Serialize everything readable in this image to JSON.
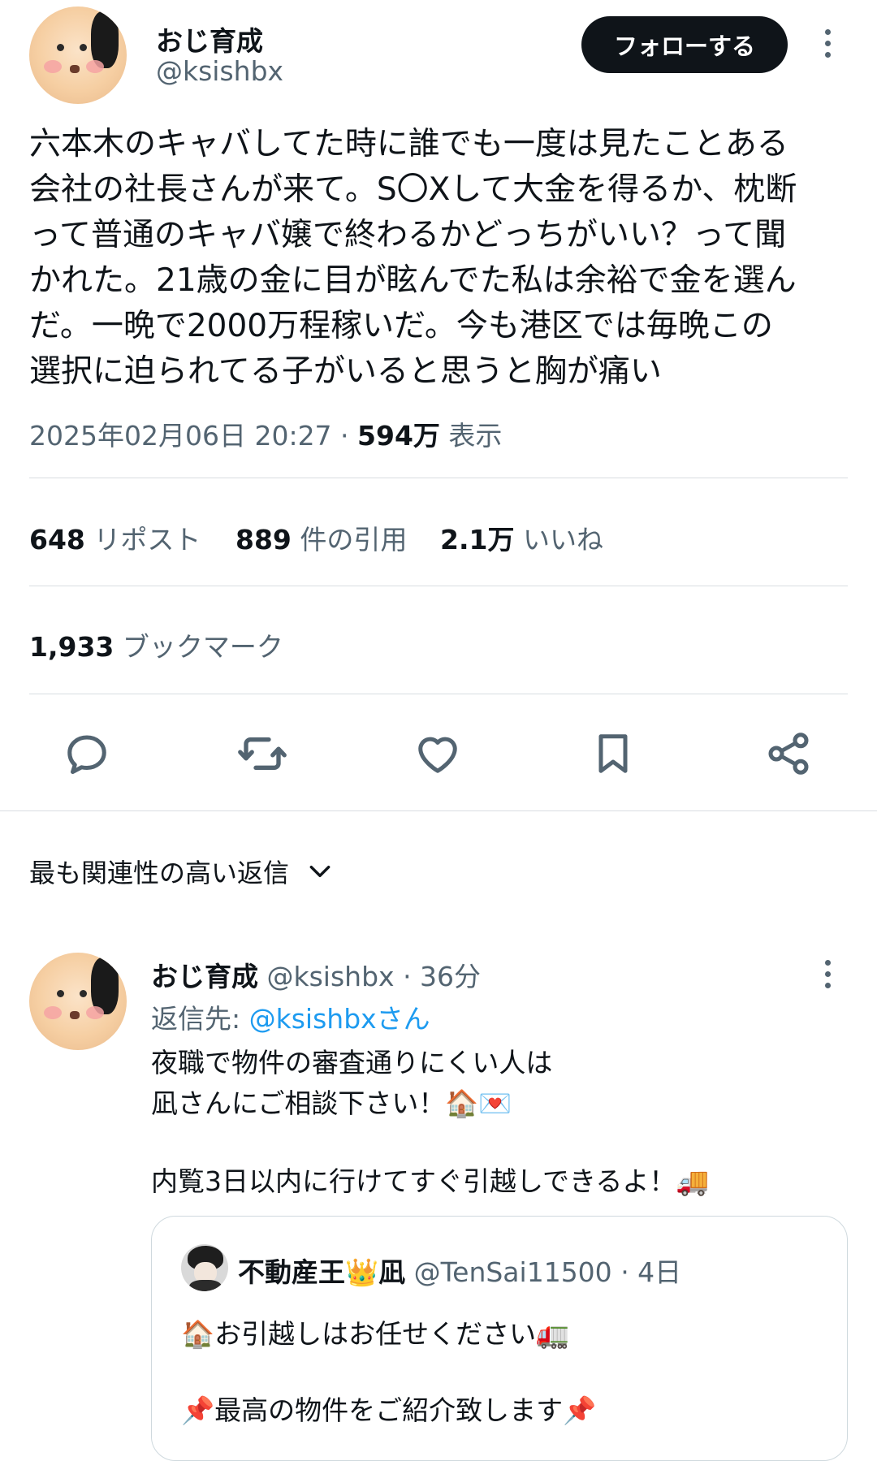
{
  "post": {
    "author_name": "おじ育成",
    "author_handle": "@ksishbx",
    "follow_label": "フォローする",
    "text_lines": [
      "六本木のキャバしてた時に誰でも一度は見たことある",
      "会社の社長さんが来て。S〇Xして大金を得るか、枕断",
      "って普通のキャバ嬢で終わるかどっちがいい？って聞",
      "かれた。21歳の金に目が眩んでた私は余裕で金を選ん",
      "だ。一晩で2000万程稼いだ。今も港区では毎晩この",
      "選択に迫られてる子がいると思うと胸が痛い"
    ],
    "timestamp": "2025年02月06日 20:27",
    "separator": " · ",
    "views_count": "594万",
    "views_label": " 表示"
  },
  "stats": {
    "reposts_count": "648",
    "reposts_label": "リポスト",
    "quotes_count": "889",
    "quotes_label": "件の引用",
    "likes_count": "2.1万",
    "likes_label": "いいね",
    "bookmarks_count": "1,933",
    "bookmarks_label": "ブックマーク"
  },
  "actions": {
    "reply_icon": "reply-icon",
    "retweet_icon": "retweet-icon",
    "like_icon": "heart-icon",
    "bookmark_icon": "bookmark-icon",
    "share_icon": "share-icon"
  },
  "replies_sort": {
    "label": "最も関連性の高い返信"
  },
  "reply": {
    "author_name": "おじ育成",
    "author_handle": "@ksishbx",
    "time": "· 36分",
    "reply_to_prefix": "返信先: ",
    "reply_to_handle": "@ksishbxさん",
    "text_lines": [
      "夜職で物件の審査通りにくい人は",
      "凪さんにご相談下さい！🏠💌",
      "",
      "内覧3日以内に行けてすぐ引越しできるよ！🚚"
    ]
  },
  "quote": {
    "author_name": "不動産王👑凪",
    "author_handle": "@TenSai11500",
    "time": "· 4日",
    "text_lines": [
      "🏠お引越しはお任せください🚛",
      "",
      "📌最高の物件をご紹介致します📌"
    ]
  },
  "colors": {
    "text": "#0f1419",
    "muted": "#536471",
    "link": "#1d9bf0",
    "divider": "#d8dde1",
    "button_bg": "#0f1419"
  }
}
